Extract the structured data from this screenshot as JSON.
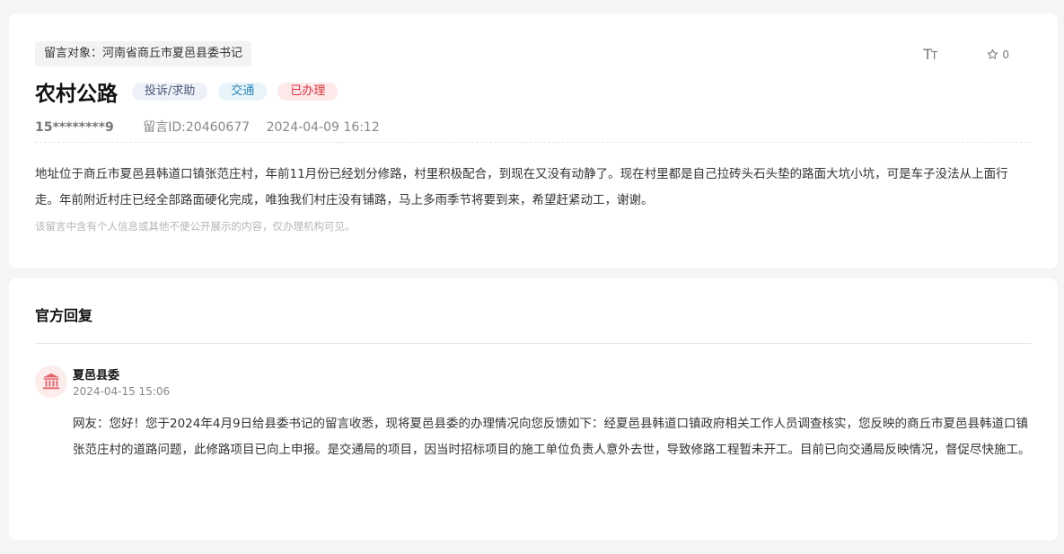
{
  "message": {
    "target": "留言对象：河南省商丘市夏邑县委书记",
    "title": "农村公路",
    "tags": [
      "投诉/求助",
      "交通",
      "已办理"
    ],
    "font_toggle": "TT",
    "favorites_count": "0",
    "user": "15********9",
    "message_id": "留言ID:20460677",
    "datetime": "2024-04-09 16:12",
    "content": "地址位于商丘市夏邑县韩道口镇张范庄村，年前11月份已经划分修路，村里积极配合，到现在又没有动静了。现在村里都是自己拉砖头石头垫的路面大坑小坑，可是车子没法从上面行走。年前附近村庄已经全部路面硬化完成，唯独我们村庄没有铺路，马上多雨季节将要到来，希望赶紧动工，谢谢。",
    "privacy_notice": "该留言中含有个人信息或其他不便公开展示的内容，仅办理机构可见。"
  },
  "reply": {
    "section_title": "官方回复",
    "org_name": "夏邑县委",
    "datetime": "2024-04-15 15:06",
    "content": "网友：您好！您于2024年4月9日给县委书记的留言收悉，现将夏邑县委的办理情况向您反馈如下：经夏邑县韩道口镇政府相关工作人员调查核实，您反映的商丘市夏邑县韩道口镇张范庄村的道路问题，此修路项目已向上申报。是交通局的项目，因当时招标项目的施工单位负责人意外去世，导致修路工程暂未开工。目前已向交通局反映情况，督促尽快施工。"
  },
  "icons": {
    "font_size": "font-size-icon",
    "star": "star-icon",
    "org": "government-building-icon"
  },
  "colors": {
    "tag_status": "#d8343f",
    "tag_category": "#2b86b5",
    "avatar_bg": "#fdecec",
    "avatar_icon": "#e0606a"
  }
}
